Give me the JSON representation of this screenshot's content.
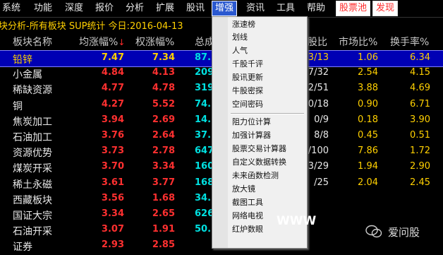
{
  "menu": [
    {
      "label": "系统"
    },
    {
      "label": "功能"
    },
    {
      "label": "深度"
    },
    {
      "label": "报价"
    },
    {
      "label": "分析"
    },
    {
      "label": "扩展"
    },
    {
      "label": "股讯"
    },
    {
      "label": "增强"
    },
    {
      "label": "资讯"
    },
    {
      "label": "工具"
    },
    {
      "label": "帮助"
    },
    {
      "label": "股票池"
    },
    {
      "label": "发现"
    }
  ],
  "title": "块分析-所有板块 SUP统计 今日:2016-04-13",
  "headers": {
    "name": "板块名称",
    "avg_change": "均涨幅%",
    "avg_arrow": "↓",
    "weighted_change": "权涨幅%",
    "volume": "总成",
    "ratio": "股比",
    "market_ratio": "市场比%",
    "turnover": "换手率%"
  },
  "rows": [
    {
      "name": "铅锌",
      "avg": "7.47",
      "wgt": "7.34",
      "vol": "87.",
      "ratio": "3/13",
      "mkt": "1.06",
      "turn": "6.34"
    },
    {
      "name": "小金属",
      "avg": "4.84",
      "wgt": "4.13",
      "vol": "209.",
      "ratio": "7/32",
      "mkt": "2.54",
      "turn": "4.15"
    },
    {
      "name": "稀缺资源",
      "avg": "4.77",
      "wgt": "4.78",
      "vol": "319.",
      "ratio": "2/51",
      "mkt": "3.88",
      "turn": "4.69"
    },
    {
      "name": "铜",
      "avg": "4.27",
      "wgt": "5.52",
      "vol": "74.",
      "ratio": "0/18",
      "mkt": "0.90",
      "turn": "6.71"
    },
    {
      "name": "焦炭加工",
      "avg": "3.94",
      "wgt": "2.69",
      "vol": "14.",
      "ratio": "0/9",
      "mkt": "0.18",
      "turn": "3.90"
    },
    {
      "name": "石油加工",
      "avg": "3.76",
      "wgt": "2.64",
      "vol": "37.",
      "ratio": "8/8",
      "mkt": "0.45",
      "turn": "0.51"
    },
    {
      "name": "资源优势",
      "avg": "3.73",
      "wgt": "2.78",
      "vol": "647.",
      "ratio": "/100",
      "mkt": "7.86",
      "turn": "1.72"
    },
    {
      "name": "煤炭开采",
      "avg": "3.70",
      "wgt": "3.34",
      "vol": "160.",
      "ratio": "3/29",
      "mkt": "1.94",
      "turn": "2.90"
    },
    {
      "name": "稀土永磁",
      "avg": "3.61",
      "wgt": "3.77",
      "vol": "168.",
      "ratio": "/25",
      "mkt": "2.04",
      "turn": "2.45"
    },
    {
      "name": "西藏板块",
      "avg": "3.56",
      "wgt": "1.68",
      "vol": "34.",
      "ratio": "",
      "mkt": "",
      "turn": ""
    },
    {
      "name": "国证大宗",
      "avg": "3.34",
      "wgt": "2.65",
      "vol": "626.",
      "ratio": "",
      "mkt": "",
      "turn": ""
    },
    {
      "name": "石油开采",
      "avg": "3.07",
      "wgt": "1.91",
      "vol": "50.",
      "ratio": "",
      "mkt": "",
      "turn": ""
    },
    {
      "name": "证券",
      "avg": "2.93",
      "wgt": "2.85",
      "vol": "",
      "ratio": "",
      "mkt": "",
      "turn": ""
    }
  ],
  "dropdown_items": [
    {
      "label": "涨速榜"
    },
    {
      "label": "划线"
    },
    {
      "label": "人气"
    },
    {
      "label": "千股千评"
    },
    {
      "label": "股讯更新"
    },
    {
      "label": "牛股密探"
    },
    {
      "label": "空间密码"
    },
    {
      "label": "阻力位计算"
    },
    {
      "label": "加强计算器"
    },
    {
      "label": "股票交易计算器"
    },
    {
      "label": "自定义数据转换"
    },
    {
      "label": "未来函数检测"
    },
    {
      "label": "放大镜"
    },
    {
      "label": "截图工具"
    },
    {
      "label": "网络电视"
    },
    {
      "label": "红炉数眼"
    }
  ],
  "watermark": "WWW",
  "brand": "爱问股"
}
